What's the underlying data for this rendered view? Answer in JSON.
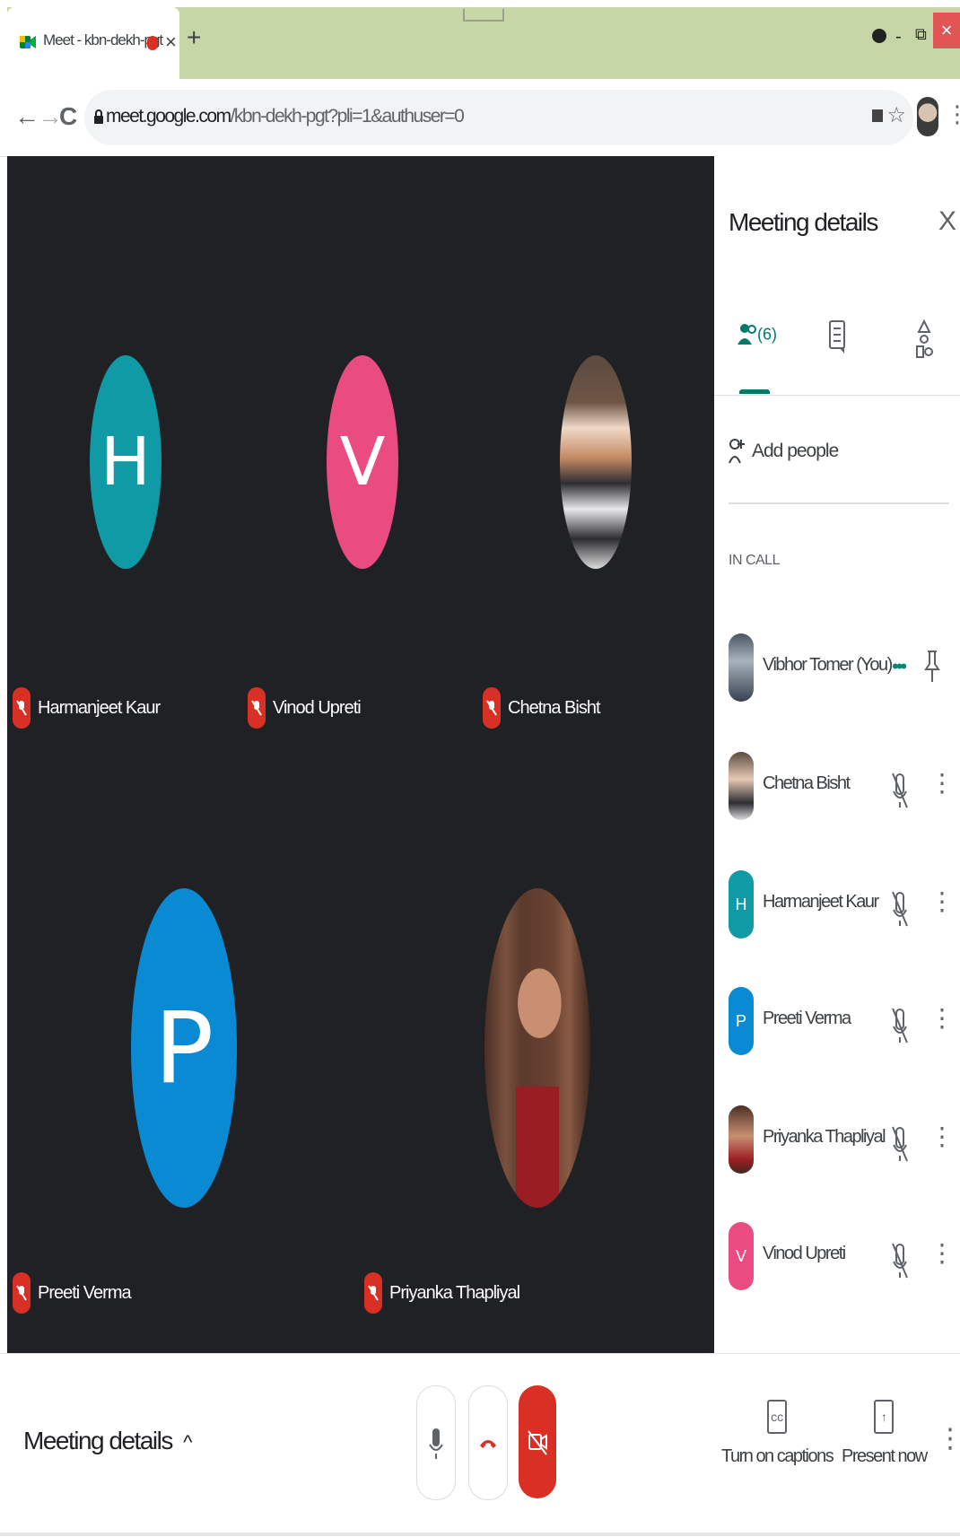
{
  "browser": {
    "tab_title": "Meet - kbn-dekh-pgt",
    "tab_close": "×",
    "new_tab": "+",
    "url_host": "meet.google.com",
    "url_path": "/kbn-dekh-pgt?pli=1&authuser=0",
    "window_min": "-",
    "window_max": "⧉",
    "window_close": "×",
    "back": "←",
    "forward": "→",
    "reload": "C",
    "star": "☆",
    "menu": "⋮"
  },
  "tiles": [
    {
      "name": "Harmanjeet Kaur",
      "initial": "H",
      "color": "#0f9aa5"
    },
    {
      "name": "Vinod Upreti",
      "initial": "V",
      "color": "#ea4c82"
    },
    {
      "name": "Chetna Bisht",
      "initial": "",
      "photo": true
    },
    {
      "name": "Preeti Verma",
      "initial": "P",
      "color": "#0b8ad4"
    },
    {
      "name": "Priyanka Thapliyal",
      "initial": "",
      "photo": true
    }
  ],
  "panel": {
    "title": "Meeting details",
    "close": "X",
    "people_count": "(6)",
    "add_people": "Add people",
    "in_call_label": "IN CALL",
    "participants": [
      {
        "name": "Vibhor Tomer (You)",
        "initial": "",
        "color": "#6d7b88",
        "you": true
      },
      {
        "name": "Chetna Bisht",
        "initial": "",
        "color": "#b9897a"
      },
      {
        "name": "Harmanjeet Kaur",
        "initial": "H",
        "color": "#0f9aa5"
      },
      {
        "name": "Preeti Verma",
        "initial": "P",
        "color": "#0b8ad4"
      },
      {
        "name": "Priyanka Thapliyal",
        "initial": "",
        "color": "#8a4b4b"
      },
      {
        "name": "Vinod Upreti",
        "initial": "V",
        "color": "#ea4c82"
      }
    ]
  },
  "bottom": {
    "meeting_details": "Meeting details",
    "captions": "Turn on captions",
    "present": "Present now"
  },
  "colors": {
    "accent_teal": "#00796b",
    "danger_red": "#d93025",
    "tile_bg": "#202124",
    "tab_strip": "#c7d6a6"
  }
}
